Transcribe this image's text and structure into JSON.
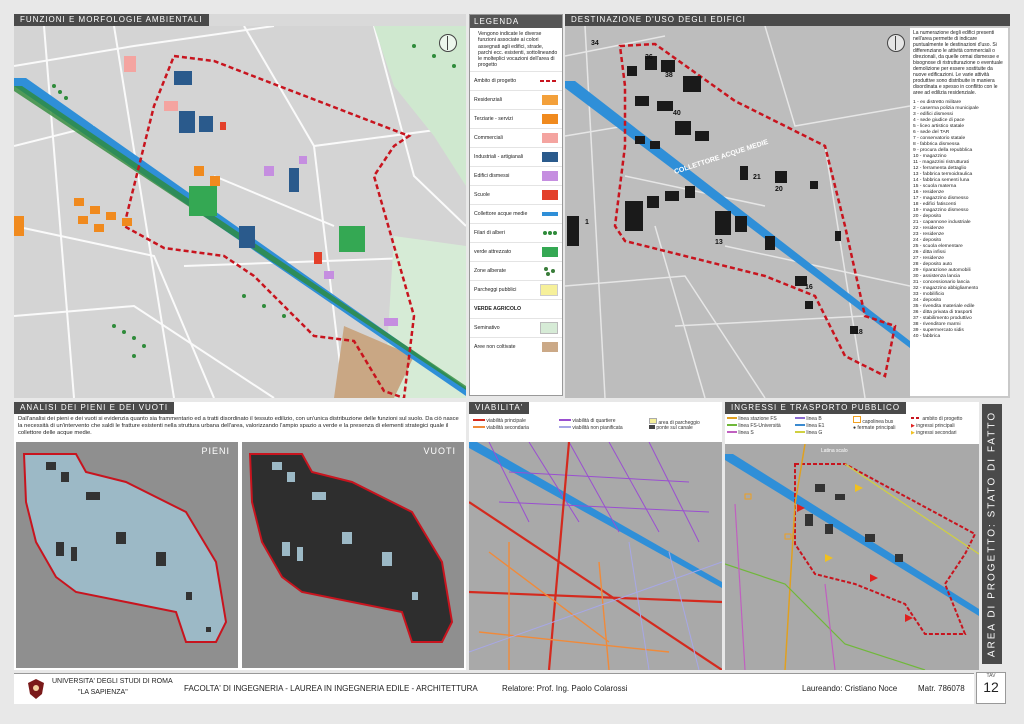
{
  "panels": {
    "funzioni_title": "FUNZIONI E MORFOLOGIE AMBIENTALI",
    "destinazione_title": "DESTINAZIONE D'USO DEGLI EDIFICI",
    "analisi_title": "ANALISI DEI PIENI E DEI VUOTI",
    "viabilita_title": "VIABILITA'",
    "ingressi_title": "INGRESSI E TRASPORTO PUBBLICO"
  },
  "legend": {
    "title": "LEGENDA",
    "intro": "Vengono indicate le diverse funzioni associate ai colori assegnati agli edifici, strade, parchi ecc. esistenti, sottolineando le molteplici vocazioni dell'area di progetto",
    "items": [
      {
        "label": "Ambito di progetto",
        "color": "#c8141e"
      },
      {
        "label": "Residenziali",
        "color": "#f3a03a"
      },
      {
        "label": "Terziarie - servizi",
        "color": "#f08a1e"
      },
      {
        "label": "Commerciali",
        "color": "#f4a4a0"
      },
      {
        "label": "Industriali - artigianali",
        "color": "#2a5a8c"
      },
      {
        "label": "Edifici dismessi",
        "color": "#c58ee0"
      },
      {
        "label": "Scuole",
        "color": "#e3402a"
      },
      {
        "label": "Collettore acque medie",
        "color": "#2f8fd8"
      },
      {
        "label": "Filari di alberi",
        "color": "#2e8b3a"
      },
      {
        "label": "verde attrezzato",
        "color": "#34a853"
      },
      {
        "label": "Zone alberate",
        "color": "#3a7d3a"
      },
      {
        "label": "Parcheggi pubblici",
        "color": "#f6f09a"
      }
    ],
    "agricolo_title": "VERDE AGRICOLO",
    "agricolo_items": [
      {
        "label": "Seminativo",
        "color": "#d6ebd6"
      },
      {
        "label": "Aree non coltivate",
        "color": "#cba987"
      }
    ]
  },
  "destinazione": {
    "intro": "La numerazione degli edifici presenti nell'area permette di indicare puntualmente le destinazioni d'uso. Si differenziano le attività commerciali o direzionali, da quelle ormai dismesse e bisognose di ristrutturazione o eventuale demolizione per essere sostituite da nuove edificazioni. Le varie attività produttive sono distribuite in maniera disordinata e spesso in conflitto con le aree ad edilizia residenziale.",
    "buildings": [
      "1 - ex distretto militare",
      "2 - caserma polizia municipale",
      "3 - edifici dismessi",
      "4 - sede giudice di pace",
      "5 - liceo artistico statale",
      "6 - sede del TAR",
      "7 - conservatorio statale",
      "8 - fabbrica dismessa",
      "9 - procura della repubblica",
      "10 - magazzino",
      "11 - magazzini ristrutturati",
      "12 - ferramenta dettaglio",
      "13 - fabbrica termoidraulica",
      "14 - fabbrica sementi luna",
      "15 - scuola materna",
      "16 - residenze",
      "17 - magazzino dismesso",
      "18 - edifici fatiscenti",
      "19 - magazzino dismesso",
      "20 - deposito",
      "21 - capannone industriale",
      "22 - residenze",
      "23 - residenze",
      "24 - deposito",
      "25 - scuola elementare",
      "26 - ditta infissi",
      "27 - residenze",
      "28 - deposito auto",
      "29 - riparazione automobili",
      "30 - assistenza lancia",
      "31 - concessionario lancia",
      "32 - magazzino abbigliamento",
      "33 - mobilificio",
      "34 - deposito",
      "35 - rivendita materiale edile",
      "36 - ditta privata di trasporti",
      "37 - stabilimento produttivo",
      "38 - rivenditore marmi",
      "39 - supermercato sidis",
      "40 - fabbrica"
    ],
    "collettore_label": "COLLETTORE ACQUE MEDIE"
  },
  "analisi": {
    "text": "Dall'analisi dei pieni e dei vuoti si evidenzia quanto sia frammentario ed a tratti disordinato il tessuto edilizio, con un'unica distribuzione delle funzioni sul suolo. Da ciò nasce la necessità di un'intervento che saldi le fratture esistenti nella struttura urbana dell'area, valorizzando l'ampio spazio a verde e la presenza di elementi strategici quale il collettore delle acque medie.",
    "pieni": "PIENI",
    "vuoti": "VUOTI"
  },
  "viabilita": {
    "items": [
      {
        "label": "viabilità principale",
        "color": "#d42a1e"
      },
      {
        "label": "viabilità secondaria",
        "color": "#f08a3a"
      },
      {
        "label": "viabilità di quartiere",
        "color": "#9a4fd0"
      },
      {
        "label": "viabilità non pianificata",
        "color": "#a7a7e6"
      },
      {
        "label": "area di parcheggio",
        "color": "#f6f09a"
      },
      {
        "label": "ponte sul canale",
        "color": "#444444"
      }
    ]
  },
  "ingressi": {
    "items": [
      {
        "label": "linea stazione FS",
        "color": "#e0a020"
      },
      {
        "label": "linea FS-Università",
        "color": "#70b83a"
      },
      {
        "label": "linea S",
        "color": "#c060c0"
      },
      {
        "label": "linea B",
        "color": "#8a6ad0"
      },
      {
        "label": "linea E1",
        "color": "#3a8ad0"
      },
      {
        "label": "linea G",
        "color": "#d0d040"
      },
      {
        "label": "capolinea bus",
        "color": "#f0a020"
      },
      {
        "label": "fermate principali",
        "color": "#333333"
      },
      {
        "label": "ambito di progetto",
        "color": "#c8141e"
      },
      {
        "label": "ingressi principali",
        "color": "#e0201e"
      },
      {
        "label": "ingressi secondari",
        "color": "#f0c020"
      }
    ],
    "latina_scalo": "Latina scalo"
  },
  "footer": {
    "university_line1": "UNIVERSITA' DEGLI STUDI DI ROMA",
    "university_line2": "\"LA SAPIENZA\"",
    "faculty": "FACOLTA' DI INGEGNERIA  -  LAUREA IN INGEGNERIA EDILE - ARCHITETTURA",
    "relatore": "Relatore: Prof. Ing. Paolo Colarossi",
    "laureando": "Laureando: Cristiano Noce",
    "matricola": "Matr. 786078",
    "tav_label": "TAV",
    "tav_number": "12"
  },
  "side_title": "AREA DI PROGETTO: STATO DI FATTO"
}
